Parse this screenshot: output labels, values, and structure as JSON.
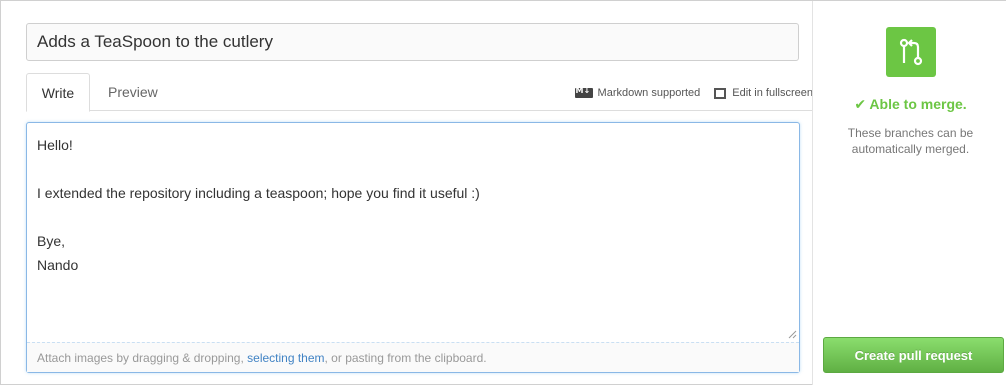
{
  "pull_request": {
    "title_value": "Adds a TeaSpoon to the cutlery"
  },
  "tabs": {
    "write": "Write",
    "preview": "Preview"
  },
  "tools": {
    "markdown_label": "Markdown supported",
    "fullscreen_label": "Edit in fullscreen"
  },
  "editor": {
    "body": "Hello!\n\nI extended the repository including a teaspoon; hope you find it useful :)\n\nBye,\nNando",
    "attach_prefix": "Attach images by dragging & dropping, ",
    "attach_link": "selecting them",
    "attach_suffix": ", or pasting from the clipboard."
  },
  "merge": {
    "status": "✔ Able to merge.",
    "description": "These branches can be automatically merged.",
    "icon": "git-pull-request-icon"
  },
  "actions": {
    "create_label": "Create pull request"
  },
  "colors": {
    "success_green": "#6cc644",
    "link_blue": "#4183c4",
    "focus_blue": "#8ab8e6"
  }
}
